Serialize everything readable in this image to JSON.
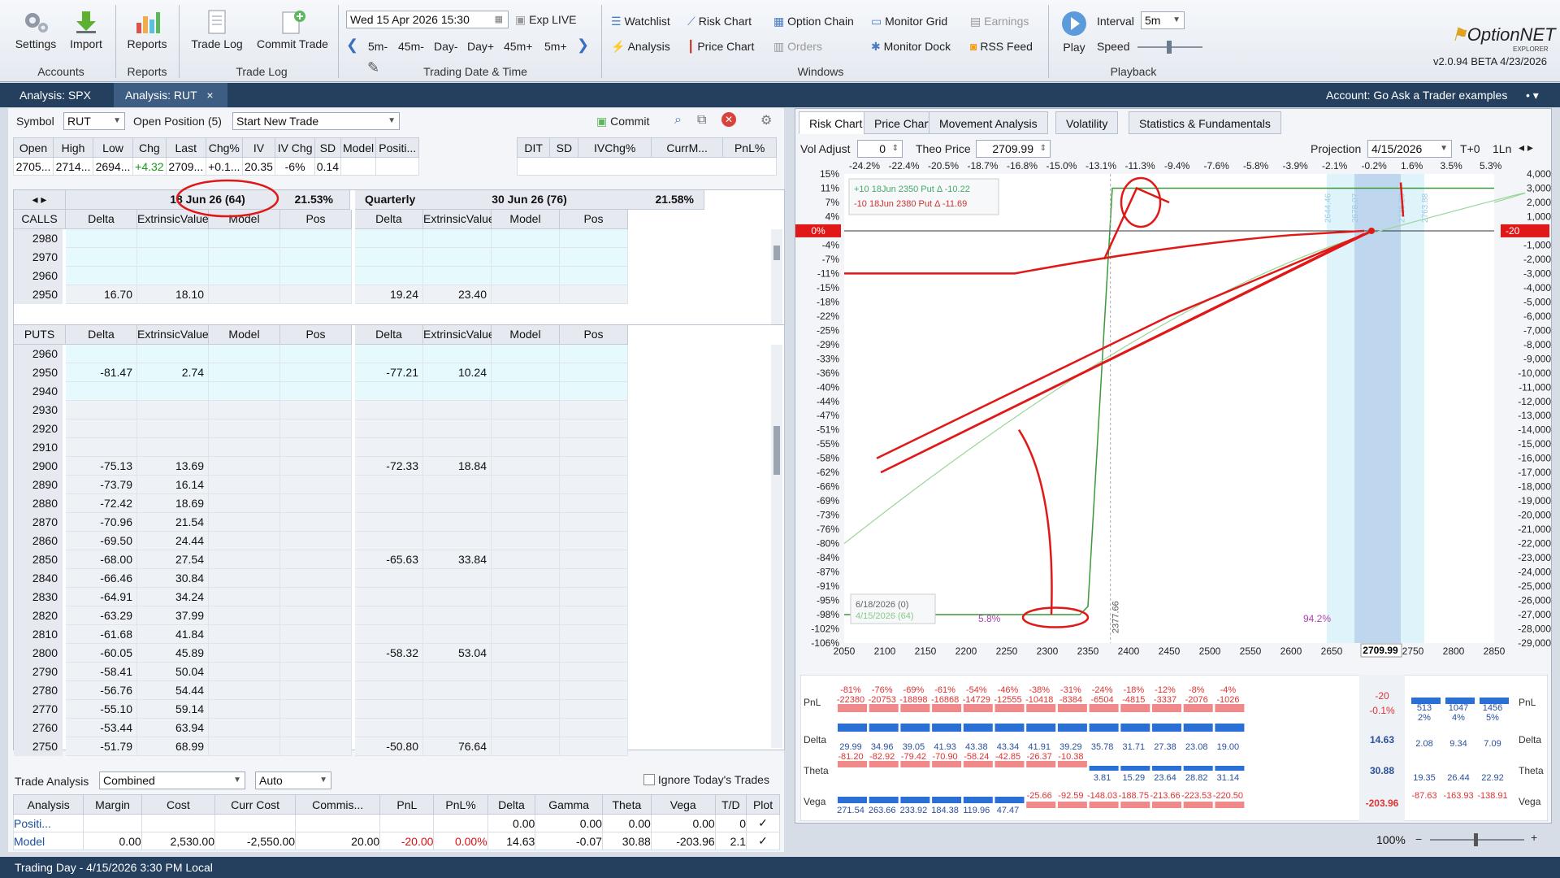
{
  "ribbon": {
    "buttons": [
      {
        "id": "settings",
        "label": "Settings"
      },
      {
        "id": "import",
        "label": "Import"
      },
      {
        "id": "reports",
        "label": "Reports"
      },
      {
        "id": "tradelog",
        "label": "Trade Log"
      },
      {
        "id": "commit",
        "label": "Commit Trade"
      }
    ],
    "groups": {
      "accounts": "Accounts",
      "reports": "Reports",
      "tradelog": "Trade Log",
      "datetime": "Trading Date & Time",
      "windows": "Windows",
      "playback": "Playback"
    },
    "datetime": "Wed 15 Apr 2026 15:30",
    "exp_live": "Exp LIVE",
    "steps": [
      "5m-",
      "45m-",
      "Day-",
      "Day+",
      "45m+",
      "5m+"
    ],
    "windows": {
      "watchlist": "Watchlist",
      "risk_chart": "Risk Chart",
      "option_chain": "Option Chain",
      "monitor_grid": "Monitor Grid",
      "earnings": "Earnings",
      "analysis": "Analysis",
      "price_chart": "Price Chart",
      "orders": "Orders",
      "monitor_dock": "Monitor Dock",
      "rss_feed": "RSS Feed"
    },
    "play": "Play",
    "interval_label": "Interval",
    "interval": "5m",
    "speed_label": "Speed",
    "brand": "OptionNET",
    "brand_sub": "EXPLORER",
    "version": "v2.0.94 BETA 4/23/2026"
  },
  "doc_tabs": {
    "tab1": "Analysis: SPX",
    "tab2": "Analysis: RUT",
    "close": "×",
    "account": "Account: Go Ask a Trader examples"
  },
  "left": {
    "symbol_label": "Symbol",
    "symbol": "RUT",
    "open_position": "Open Position (5)",
    "trade_select": "Start New Trade",
    "commit": "Commit",
    "quote_headers": [
      "Open",
      "High",
      "Low",
      "Chg",
      "Last",
      "Chg%",
      "IV",
      "IV Chg",
      "SD",
      "Model",
      "Positi..."
    ],
    "quote_values": [
      "2705...",
      "2714...",
      "2694...",
      "+4.32",
      "2709...",
      "+0.1...",
      "20.35",
      "-6%",
      "0.14",
      "",
      ""
    ],
    "quote_headers2": [
      "DIT",
      "SD",
      "IVChg%",
      "CurrM...",
      "PnL%"
    ],
    "exp1": {
      "title": "18 Jun 26 (64)",
      "iv": "21.53%"
    },
    "exp2": {
      "label": "Quarterly",
      "title": "30 Jun 26 (76)",
      "iv": "21.58%"
    },
    "calls_label": "CALLS",
    "puts_label": "PUTS",
    "col_headers": [
      "Delta",
      "ExtrinsicValue",
      "Model",
      "Pos"
    ],
    "calls": [
      {
        "strike": "2980",
        "d1": "",
        "e1": "",
        "d2": "",
        "e2": ""
      },
      {
        "strike": "2970",
        "d1": "",
        "e1": "",
        "d2": "",
        "e2": ""
      },
      {
        "strike": "2960",
        "d1": "",
        "e1": "",
        "d2": "",
        "e2": ""
      },
      {
        "strike": "2950",
        "d1": "16.70",
        "e1": "18.10",
        "d2": "19.24",
        "e2": "23.40"
      }
    ],
    "puts": [
      {
        "strike": "2960",
        "d1": "",
        "e1": "",
        "d2": "",
        "e2": ""
      },
      {
        "strike": "2950",
        "d1": "-81.47",
        "e1": "2.74",
        "d2": "-77.21",
        "e2": "10.24"
      },
      {
        "strike": "2940",
        "d1": "",
        "e1": "",
        "d2": "",
        "e2": ""
      },
      {
        "strike": "2930",
        "d1": "",
        "e1": "",
        "d2": "",
        "e2": ""
      },
      {
        "strike": "2920",
        "d1": "",
        "e1": "",
        "d2": "",
        "e2": ""
      },
      {
        "strike": "2910",
        "d1": "",
        "e1": "",
        "d2": "",
        "e2": ""
      },
      {
        "strike": "2900",
        "d1": "-75.13",
        "e1": "13.69",
        "d2": "-72.33",
        "e2": "18.84"
      },
      {
        "strike": "2890",
        "d1": "-73.79",
        "e1": "16.14",
        "d2": "",
        "e2": ""
      },
      {
        "strike": "2880",
        "d1": "-72.42",
        "e1": "18.69",
        "d2": "",
        "e2": ""
      },
      {
        "strike": "2870",
        "d1": "-70.96",
        "e1": "21.54",
        "d2": "",
        "e2": ""
      },
      {
        "strike": "2860",
        "d1": "-69.50",
        "e1": "24.44",
        "d2": "",
        "e2": ""
      },
      {
        "strike": "2850",
        "d1": "-68.00",
        "e1": "27.54",
        "d2": "-65.63",
        "e2": "33.84"
      },
      {
        "strike": "2840",
        "d1": "-66.46",
        "e1": "30.84",
        "d2": "",
        "e2": ""
      },
      {
        "strike": "2830",
        "d1": "-64.91",
        "e1": "34.24",
        "d2": "",
        "e2": ""
      },
      {
        "strike": "2820",
        "d1": "-63.29",
        "e1": "37.99",
        "d2": "",
        "e2": ""
      },
      {
        "strike": "2810",
        "d1": "-61.68",
        "e1": "41.84",
        "d2": "",
        "e2": ""
      },
      {
        "strike": "2800",
        "d1": "-60.05",
        "e1": "45.89",
        "d2": "-58.32",
        "e2": "53.04"
      },
      {
        "strike": "2790",
        "d1": "-58.41",
        "e1": "50.04",
        "d2": "",
        "e2": ""
      },
      {
        "strike": "2780",
        "d1": "-56.76",
        "e1": "54.44",
        "d2": "",
        "e2": ""
      },
      {
        "strike": "2770",
        "d1": "-55.10",
        "e1": "59.14",
        "d2": "",
        "e2": ""
      },
      {
        "strike": "2760",
        "d1": "-53.44",
        "e1": "63.94",
        "d2": "",
        "e2": ""
      },
      {
        "strike": "2750",
        "d1": "-51.79",
        "e1": "68.99",
        "d2": "-50.80",
        "e2": "76.64"
      }
    ],
    "trade_analysis_label": "Trade Analysis",
    "ta_mode": "Combined",
    "ta_auto": "Auto",
    "ignore_today": "Ignore Today's Trades",
    "ta_headers": [
      "Analysis",
      "Margin",
      "Cost",
      "Curr Cost",
      "Commis...",
      "PnL",
      "PnL%",
      "Delta",
      "Gamma",
      "Theta",
      "Vega",
      "T/D",
      "Plot"
    ],
    "ta_rows": [
      [
        "Positi...",
        "",
        "",
        "",
        "",
        "",
        "",
        "0.00",
        "0.00",
        "0.00",
        "0.00",
        "0",
        "✓"
      ],
      [
        "Model",
        "0.00",
        "2,530.00",
        "-2,550.00",
        "20.00",
        "-20.00",
        "0.00%",
        "14.63",
        "-0.07",
        "30.88",
        "-203.96",
        "2.1",
        "✓"
      ]
    ]
  },
  "right": {
    "tabs": [
      "Risk Chart",
      "Price Chart",
      "Movement Analysis",
      "Volatility",
      "Statistics & Fundamentals"
    ],
    "vol_adjust_label": "Vol Adjust",
    "vol_adjust": "0",
    "theo_label": "Theo Price",
    "theo": "2709.99",
    "projection_label": "Projection",
    "projection": "4/15/2026",
    "tplus": "T+0",
    "one_ln": "1Ln",
    "top_pcts": [
      "-24.2%",
      "-22.4%",
      "-20.5%",
      "-18.7%",
      "-16.8%",
      "-15.0%",
      "-13.1%",
      "-11.3%",
      "-9.4%",
      "-7.6%",
      "-5.8%",
      "-3.9%",
      "-2.1%",
      "-0.2%",
      "1.6%",
      "3.5%",
      "5.3%"
    ],
    "left_pcts": [
      "15%",
      "11%",
      "7%",
      "4%",
      "0%",
      "-4%",
      "-7%",
      "-11%",
      "-15%",
      "-18%",
      "-22%",
      "-25%",
      "-29%",
      "-33%",
      "-36%",
      "-40%",
      "-44%",
      "-47%",
      "-51%",
      "-55%",
      "-58%",
      "-62%",
      "-66%",
      "-69%",
      "-73%",
      "-76%",
      "-80%",
      "-84%",
      "-87%",
      "-91%",
      "-95%",
      "-98%",
      "-102%",
      "-106%"
    ],
    "right_vals": [
      "4,000",
      "3,000",
      "2,000",
      "1,000",
      "-20",
      "-1,000",
      "-2,000",
      "-3,000",
      "-4,000",
      "-5,000",
      "-6,000",
      "-7,000",
      "-8,000",
      "-9,000",
      "-10,000",
      "-11,000",
      "-12,000",
      "-13,000",
      "-14,000",
      "-15,000",
      "-16,000",
      "-17,000",
      "-18,000",
      "-19,000",
      "-20,000",
      "-21,000",
      "-22,000",
      "-23,000",
      "-24,000",
      "-25,000",
      "-26,000",
      "-27,000",
      "-28,000",
      "-29,000"
    ],
    "x_labels": [
      "2050",
      "2100",
      "2150",
      "2200",
      "2250",
      "2300",
      "2350",
      "2400",
      "2450",
      "2500",
      "2550",
      "2600",
      "2650",
      "2709.99",
      "2750",
      "2800",
      "2850"
    ],
    "legend": [
      "+10 18Jun 2350 Put Δ -10.22",
      "-10 18Jun 2380 Put Δ -11.69"
    ],
    "dates": [
      "6/18/2026 (0)",
      "4/15/2026 (64)"
    ],
    "annot": {
      "p1": "5.8%",
      "p2": "94.2%",
      "strike": "2377.66",
      "vlines": [
        "2644.46",
        "2678.07",
        "2735.29",
        "2763.88"
      ]
    },
    "greek_rows": {
      "pnl": "PnL",
      "delta": "Delta",
      "theta": "Theta",
      "vega": "Vega"
    },
    "pnl_pct": [
      "-81%",
      "-76%",
      "-69%",
      "-61%",
      "-54%",
      "-46%",
      "-38%",
      "-31%",
      "-24%",
      "-18%",
      "-12%",
      "-8%",
      "-4%"
    ],
    "pnl_val": [
      "-22380",
      "-20753",
      "-18898",
      "-16868",
      "-14729",
      "-12555",
      "-10418",
      "-8384",
      "-6504",
      "-4815",
      "-3337",
      "-2076",
      "-1026"
    ],
    "pnl_right": [
      {
        "v": "513",
        "p": "2%"
      },
      {
        "v": "1047",
        "p": "4%"
      },
      {
        "v": "1456",
        "p": "5%"
      }
    ],
    "pnl_center": {
      "v": "-20",
      "p": "-0.1%"
    },
    "delta_vals": [
      "29.99",
      "34.96",
      "39.05",
      "41.93",
      "43.38",
      "43.34",
      "41.91",
      "39.29",
      "35.78",
      "31.71",
      "27.38",
      "23.08",
      "19.00"
    ],
    "delta_center": "14.63",
    "delta_right": [
      "2.08",
      "9.34",
      "7.09"
    ],
    "theta_neg": [
      "-81.20",
      "-82.92",
      "-79.42",
      "-70.90",
      "-58.24",
      "-42.85",
      "-26.37",
      "-10.38"
    ],
    "theta_pos": [
      "3.81",
      "15.29",
      "23.64",
      "28.82",
      "31.14"
    ],
    "theta_center": "30.88",
    "theta_right": [
      "19.35",
      "26.44",
      "22.92"
    ],
    "vega_pos": [
      "271.54",
      "263.66",
      "233.92",
      "184.38",
      "119.96",
      "47.47"
    ],
    "vega_neg": [
      "-25.66",
      "-92.59",
      "-148.03",
      "-188.75",
      "-213.66",
      "-223.53",
      "-220.50"
    ],
    "vega_center": "-203.96",
    "vega_right": [
      "-87.63",
      "-163.93",
      "-138.91"
    ],
    "zoom": "100%"
  },
  "status": "Trading Day - 4/15/2026 3:30 PM Local",
  "colors": {
    "accent": "#25405f",
    "loss": "#e03030",
    "gain": "#2a6fd6",
    "annot": "#e01818"
  }
}
